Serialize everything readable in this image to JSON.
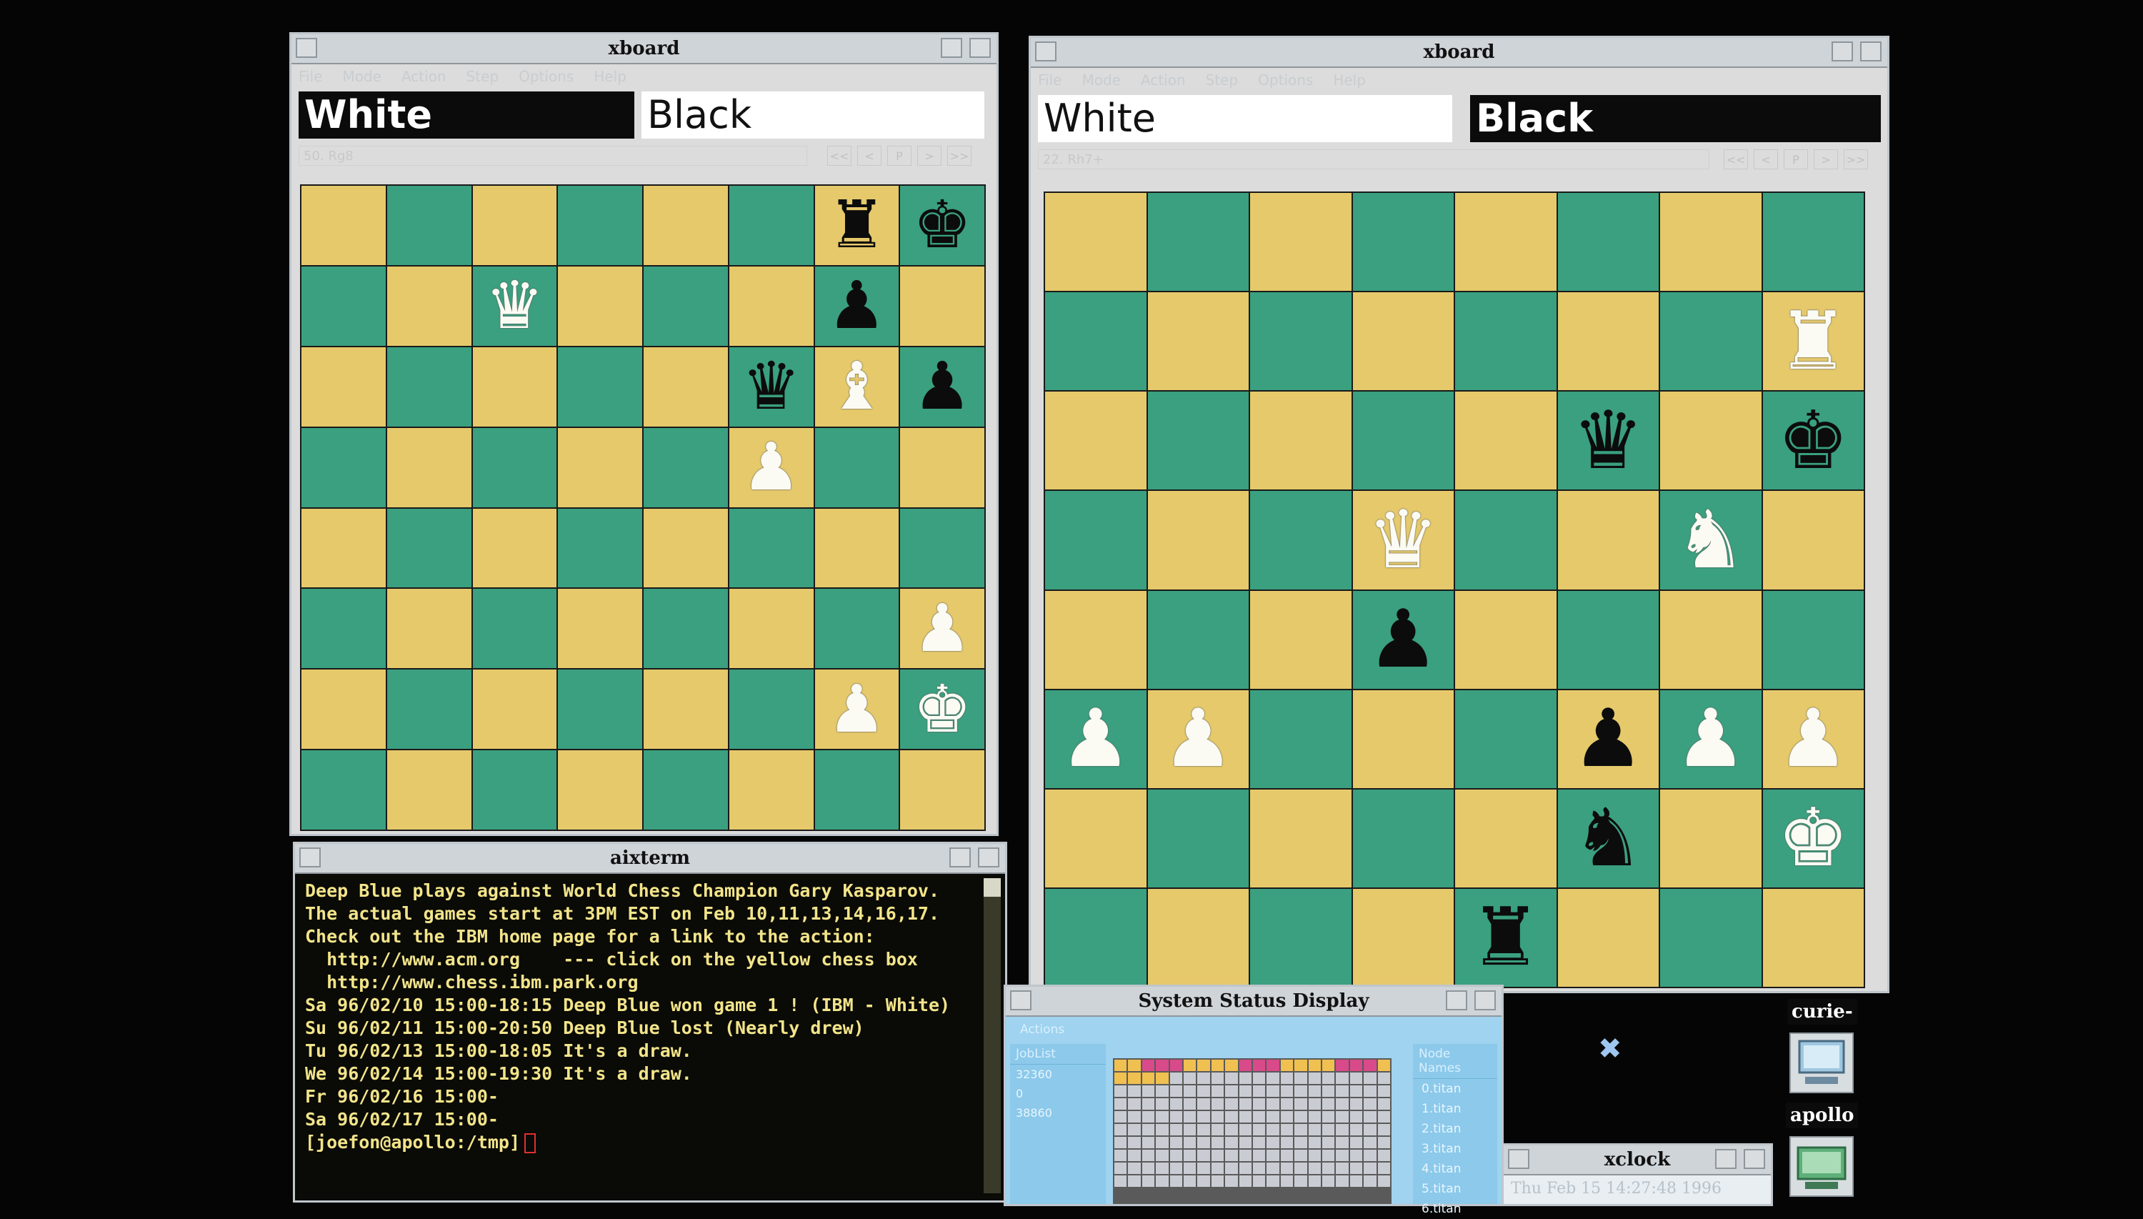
{
  "left_xboard": {
    "title": "xboard",
    "menu": [
      "File",
      "Mode",
      "Action",
      "Step",
      "Options",
      "Help"
    ],
    "white_label": "White",
    "black_label": "Black",
    "active_side": "white",
    "move_text": "50. Rg8",
    "nav_buttons": [
      "<<",
      "<",
      "P",
      ">",
      ">>"
    ],
    "board": [
      [
        null,
        null,
        null,
        null,
        null,
        null,
        "bR",
        "bK"
      ],
      [
        null,
        null,
        "wQ",
        null,
        null,
        null,
        "bP",
        null
      ],
      [
        null,
        null,
        null,
        null,
        null,
        "bQ",
        "wB",
        "bP"
      ],
      [
        null,
        null,
        null,
        null,
        null,
        "wP",
        null,
        null
      ],
      [
        null,
        null,
        null,
        null,
        null,
        null,
        null,
        null
      ],
      [
        null,
        null,
        null,
        null,
        null,
        null,
        null,
        "wP"
      ],
      [
        null,
        null,
        null,
        null,
        null,
        null,
        "wP",
        "wK"
      ],
      [
        null,
        null,
        null,
        null,
        null,
        null,
        null,
        null
      ]
    ]
  },
  "right_xboard": {
    "title": "xboard",
    "menu": [
      "File",
      "Mode",
      "Action",
      "Step",
      "Options",
      "Help"
    ],
    "white_label": "White",
    "black_label": "Black",
    "active_side": "black",
    "move_text": "22. Rh7+",
    "nav_buttons": [
      "<<",
      "<",
      "P",
      ">",
      ">>"
    ],
    "board": [
      [
        null,
        null,
        null,
        null,
        null,
        null,
        null,
        null
      ],
      [
        null,
        null,
        null,
        null,
        null,
        null,
        null,
        "wR"
      ],
      [
        null,
        null,
        null,
        null,
        null,
        "bQ",
        null,
        "bK"
      ],
      [
        null,
        null,
        null,
        "wQ",
        null,
        null,
        "wN",
        null
      ],
      [
        null,
        null,
        null,
        "bP",
        null,
        null,
        null,
        null
      ],
      [
        "wP",
        "wP",
        null,
        null,
        null,
        "bP",
        "wP",
        "wP"
      ],
      [
        null,
        null,
        null,
        null,
        null,
        "bN",
        null,
        "wK"
      ],
      [
        null,
        null,
        null,
        null,
        "bR",
        null,
        null,
        null
      ]
    ]
  },
  "aixterm": {
    "title": "aixterm",
    "lines": [
      "Deep Blue plays against World Chess Champion Gary Kasparov.",
      "The actual games start at 3PM EST on Feb 10,11,13,14,16,17.",
      "Check out the IBM home page for a link to the action:",
      "  http://www.acm.org    --- click on the yellow chess box",
      "  http://www.chess.ibm.park.org",
      "",
      "Sa 96/02/10 15:00-18:15 Deep Blue won game 1 ! (IBM - White)",
      "",
      "Su 96/02/11 15:00-20:50 Deep Blue lost (Nearly drew)",
      "Tu 96/02/13 15:00-18:05 It's a draw.",
      "We 96/02/14 15:00-19:30 It's a draw.",
      "Fr 96/02/16 15:00-",
      "Sa 96/02/17 15:00-"
    ],
    "prompt": "[joefon@apollo:/tmp]"
  },
  "system_status": {
    "title": "System Status Display",
    "actions_label": "Actions",
    "joblist_label": "JobList",
    "jobs": [
      "32360",
      "0",
      "38860"
    ],
    "node_names_label": "Node Names",
    "nodes": [
      "0.titan",
      "1.titan",
      "2.titan",
      "3.titan",
      "4.titan",
      "5.titan",
      "6.titan"
    ]
  },
  "icons": {
    "curie_label": "curie-",
    "apollo_label": "apollo"
  },
  "xclock": {
    "title": "xclock",
    "time": "Thu Feb 15 14:27:48 1996"
  },
  "colors": {
    "light_square": "#e5c96b",
    "dark_square": "#3aa07f",
    "terminal_text": "#f2e48a",
    "status_bg": "#9fd3ef"
  }
}
